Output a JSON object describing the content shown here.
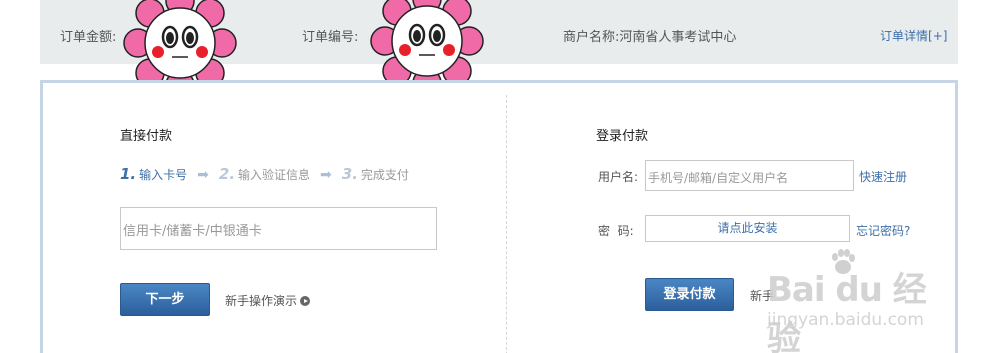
{
  "order_bar": {
    "amount_label": "订单金额:",
    "number_label": "订单编号:",
    "merchant_label": "商户名称:河南省人事考试中心",
    "detail_link": "订单详情",
    "detail_plus": "[+]"
  },
  "direct_pay": {
    "title": "直接付款",
    "steps": [
      {
        "num": "1.",
        "label": "输入卡号"
      },
      {
        "num": "2.",
        "label": "输入验证信息"
      },
      {
        "num": "3.",
        "label": "完成支付"
      }
    ],
    "card_placeholder": "信用卡/储蓄卡/中银通卡",
    "next_button": "下一步",
    "guide_link": "新手操作演示"
  },
  "login_pay": {
    "title": "登录付款",
    "username_label": "用户名:",
    "username_placeholder": "手机号/邮箱/自定义用户名",
    "register_link": "快速注册",
    "password_label": "密  码:",
    "password_install": "请点此安装",
    "forgot_link": "忘记密码?",
    "login_button": "登录付款",
    "guide_link": "新手"
  },
  "watermark": {
    "main": "Bai du 经验",
    "sub": "jingyan.baidu.com"
  },
  "colors": {
    "link_blue": "#3d6fa8",
    "button_blue": "#3a72b0",
    "flower_pink": "#f06aa8",
    "cheek_red": "#e8202a"
  },
  "icons": [
    "flower-sticker",
    "step-arrow-icon",
    "play-icon",
    "baidu-paw-icon"
  ]
}
